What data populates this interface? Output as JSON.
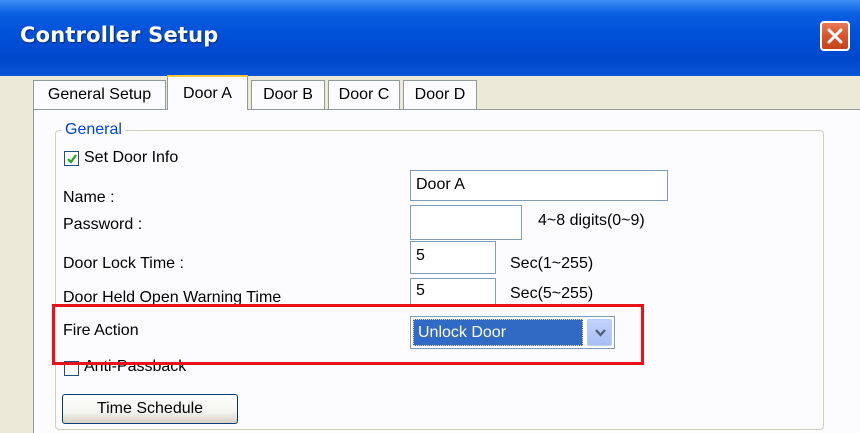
{
  "window": {
    "title": "Controller Setup"
  },
  "tabs": [
    {
      "label": "General Setup",
      "active": false
    },
    {
      "label": "Door A",
      "active": true
    },
    {
      "label": "Door B",
      "active": false
    },
    {
      "label": "Door C",
      "active": false
    },
    {
      "label": "Door D",
      "active": false
    }
  ],
  "general": {
    "group_label": "General",
    "set_door_info": {
      "label": "Set Door Info",
      "checked": true
    },
    "name": {
      "label": "Name :",
      "value": "Door A"
    },
    "password": {
      "label": "Password :",
      "value": "",
      "hint": "4~8 digits(0~9)"
    },
    "door_lock_time": {
      "label": "Door Lock Time :",
      "value": "5",
      "hint": "Sec(1~255)"
    },
    "held_open_time": {
      "label": "Door Held Open Warning Time",
      "value": "5",
      "hint": "Sec(5~255)"
    },
    "fire_action": {
      "label": "Fire Action",
      "selected": "Unlock Door"
    },
    "anti_passback": {
      "label": "Anti-Passback",
      "checked": false
    },
    "time_schedule_button": "Time Schedule"
  },
  "colors": {
    "titlebar": "#0050d8",
    "group_label": "#0046d5",
    "selection": "#316ac5",
    "highlight_box": "#e8121b",
    "active_tab_accent": "#ffc83c"
  },
  "icons": {
    "close": "close-icon",
    "checkbox_check": "checkmark-icon",
    "dropdown": "chevron-down-icon"
  }
}
